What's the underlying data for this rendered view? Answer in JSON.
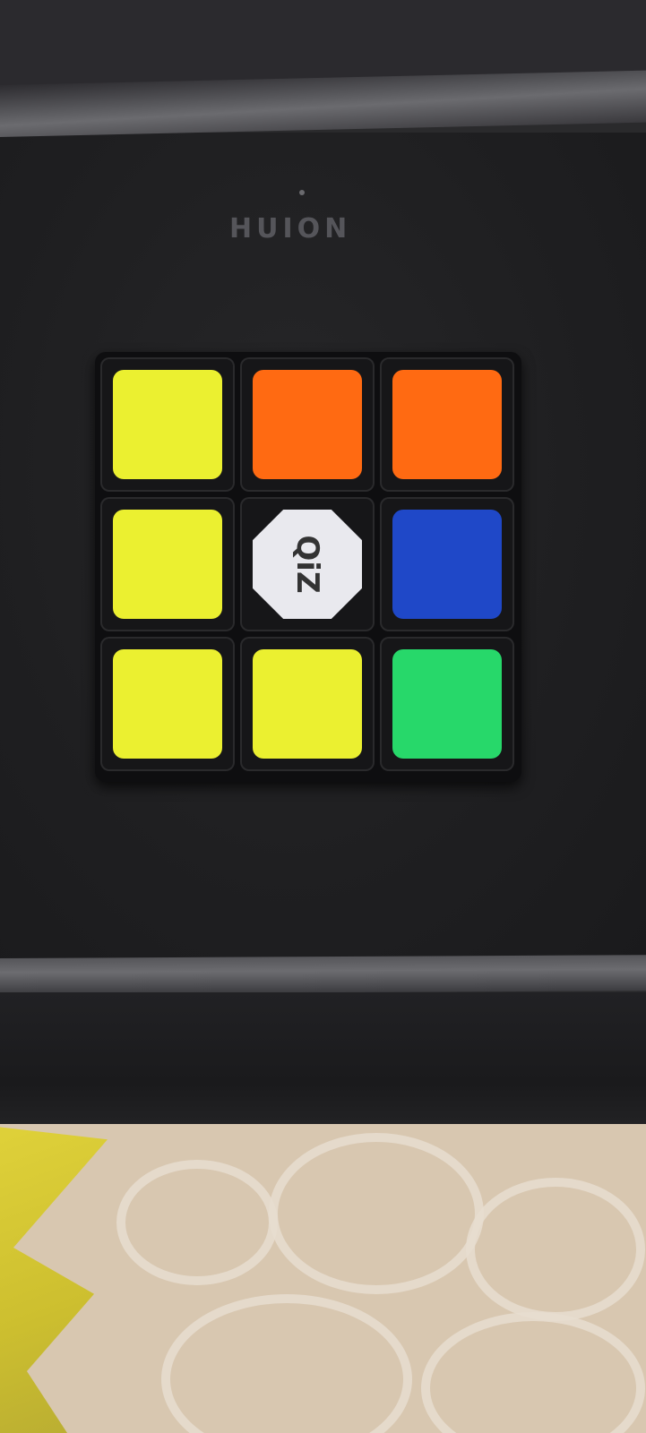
{
  "brand": {
    "text": "HUION"
  },
  "cube": {
    "center_logo": "QiZ",
    "colors": {
      "yellow": "#ebf030",
      "orange": "#ff6a12",
      "white": "#e9e9ee",
      "blue": "#1f48c8",
      "green": "#27d86a"
    },
    "face": [
      [
        "yellow",
        "orange",
        "orange"
      ],
      [
        "yellow",
        "white",
        "blue"
      ],
      [
        "yellow",
        "yellow",
        "green"
      ]
    ]
  }
}
